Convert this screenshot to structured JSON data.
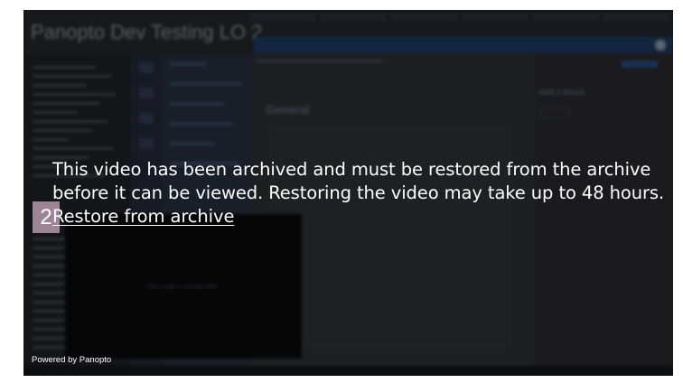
{
  "player": {
    "slide_number": "2",
    "message_line1": "This video has been archived and must be restored from the archive",
    "message_line2": "before it can be viewed. Restoring the video may take up to 48 hours.",
    "restore_link": "Restore from archive",
    "powered_by": "Powered by Panopto"
  },
  "background_recording": {
    "title": "Panopto Dev Testing LO 2",
    "heading": "General",
    "add_block": "Add a block",
    "video_prompt": "Click to sign in and play video"
  },
  "colors": {
    "badge": "#9d8497",
    "text": "#ffffff",
    "player_bg": "#17181b"
  }
}
